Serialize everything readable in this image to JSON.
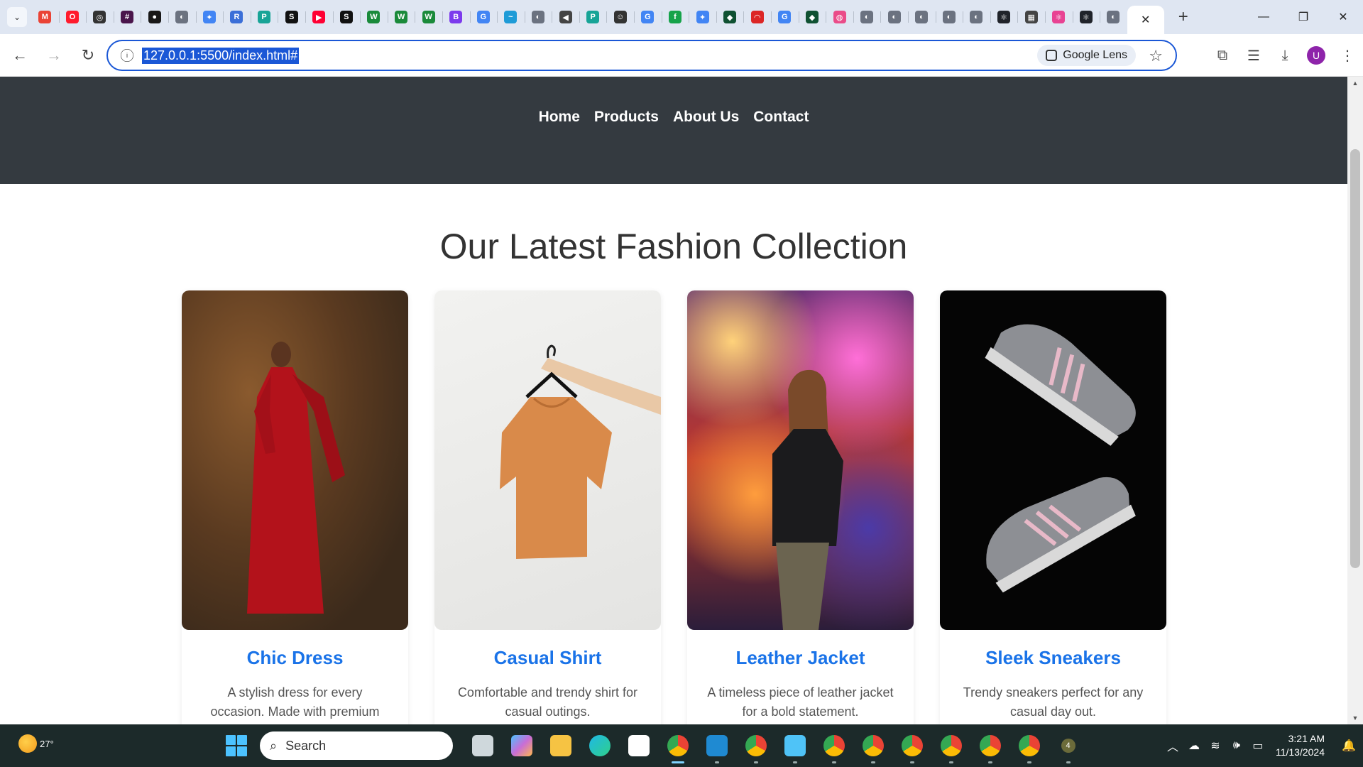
{
  "browser": {
    "tab_favicons": [
      {
        "name": "gmail",
        "color": "#ea4335",
        "glyph": "M"
      },
      {
        "name": "opera",
        "color": "#ff1b2d",
        "glyph": "O"
      },
      {
        "name": "chatgpt",
        "color": "#333333",
        "glyph": "◎"
      },
      {
        "name": "slack",
        "color": "#4a154b",
        "glyph": "#"
      },
      {
        "name": "github",
        "color": "#181717",
        "glyph": "●"
      },
      {
        "name": "generic",
        "color": "#6b7280",
        "glyph": "◐"
      },
      {
        "name": "gemini",
        "color": "#4285f4",
        "glyph": "✦"
      },
      {
        "name": "app-rs",
        "color": "#3b6fd8",
        "glyph": "R"
      },
      {
        "name": "app-p",
        "color": "#18a497",
        "glyph": "P"
      },
      {
        "name": "app-is",
        "color": "#111111",
        "glyph": "S"
      },
      {
        "name": "youtube-music",
        "color": "#ff0033",
        "glyph": "▶"
      },
      {
        "name": "app-is-2",
        "color": "#111111",
        "glyph": "S"
      },
      {
        "name": "app-w",
        "color": "#1a8a3a",
        "glyph": "W"
      },
      {
        "name": "app-w-2",
        "color": "#1a8a3a",
        "glyph": "W"
      },
      {
        "name": "app-w-3",
        "color": "#1a8a3a",
        "glyph": "W"
      },
      {
        "name": "app-b",
        "color": "#7c3aed",
        "glyph": "B"
      },
      {
        "name": "google",
        "color": "#4285f4",
        "glyph": "G"
      },
      {
        "name": "app-wave",
        "color": "#1e9bd7",
        "glyph": "~"
      },
      {
        "name": "generic-2",
        "color": "#6b7280",
        "glyph": "◐"
      },
      {
        "name": "speaker",
        "color": "#444444",
        "glyph": "◀"
      },
      {
        "name": "app-p-2",
        "color": "#18a497",
        "glyph": "P"
      },
      {
        "name": "app-face",
        "color": "#333333",
        "glyph": "☺"
      },
      {
        "name": "google-2",
        "color": "#4285f4",
        "glyph": "G"
      },
      {
        "name": "app-f",
        "color": "#16a34a",
        "glyph": "f"
      },
      {
        "name": "gemini-2",
        "color": "#4285f4",
        "glyph": "✦"
      },
      {
        "name": "app-leaf",
        "color": "#0f5132",
        "glyph": "◆"
      },
      {
        "name": "app-gauge",
        "color": "#dc2626",
        "glyph": "◠"
      },
      {
        "name": "google-3",
        "color": "#4285f4",
        "glyph": "G"
      },
      {
        "name": "app-leaf-2",
        "color": "#0f5132",
        "glyph": "◆"
      },
      {
        "name": "dribbble",
        "color": "#ea4c89",
        "glyph": "◍"
      },
      {
        "name": "generic-3",
        "color": "#6b7280",
        "glyph": "◐"
      },
      {
        "name": "generic-4",
        "color": "#6b7280",
        "glyph": "◐"
      },
      {
        "name": "generic-5",
        "color": "#6b7280",
        "glyph": "◐"
      },
      {
        "name": "generic-6",
        "color": "#6b7280",
        "glyph": "◐"
      },
      {
        "name": "generic-7",
        "color": "#6b7280",
        "glyph": "◐"
      },
      {
        "name": "react",
        "color": "#20232a",
        "glyph": "⚛"
      },
      {
        "name": "app-grid",
        "color": "#444444",
        "glyph": "▦"
      },
      {
        "name": "react-pink",
        "color": "#e84393",
        "glyph": "⚛"
      },
      {
        "name": "react-2",
        "color": "#20232a",
        "glyph": "⚛"
      },
      {
        "name": "generic-8",
        "color": "#6b7280",
        "glyph": "◐"
      }
    ],
    "url": "127.0.0.1:5500/index.html#",
    "lens_label": "Google Lens",
    "profile_initial": "U"
  },
  "site": {
    "nav": [
      "Home",
      "Products",
      "About Us",
      "Contact"
    ],
    "section_title": "Our Latest Fashion Collection",
    "products": [
      {
        "title": "Chic Dress",
        "description": "A stylish dress for every occasion. Made with premium fabric.",
        "image": "red-dress-photo"
      },
      {
        "title": "Casual Shirt",
        "description": "Comfortable and trendy shirt for casual outings.",
        "image": "orange-tshirt-on-hanger-photo"
      },
      {
        "title": "Leather Jacket",
        "description": "A timeless piece of leather jacket for a bold statement.",
        "image": "leather-jacket-carnival-photo"
      },
      {
        "title": "Sleek Sneakers",
        "description": "Trendy sneakers perfect for any casual day out.",
        "image": "grey-sneakers-photo"
      }
    ],
    "accent_color": "#1a73e8",
    "header_color": "#343a40"
  },
  "taskbar": {
    "temperature": "27°",
    "search_placeholder": "Search",
    "notification_count": "4",
    "time": "3:21 AM",
    "date": "11/13/2024"
  }
}
